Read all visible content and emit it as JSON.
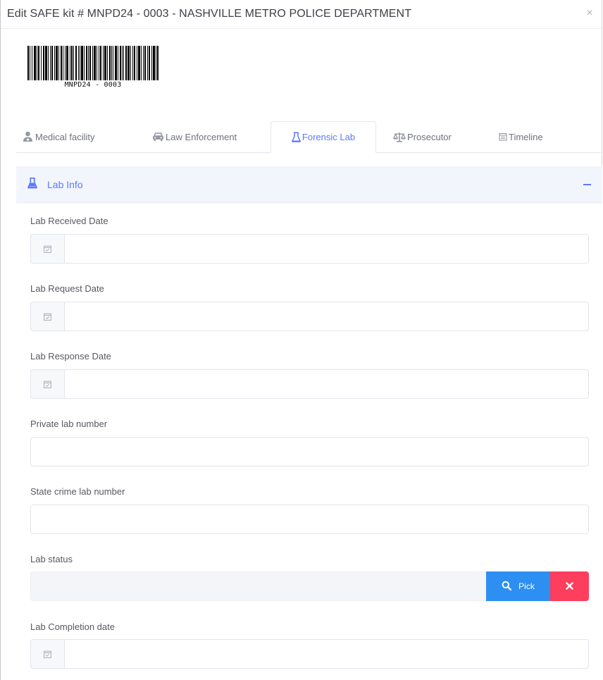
{
  "modal": {
    "title": "Edit SAFE kit # MNPD24 - 0003 - NASHVILLE METRO POLICE DEPARTMENT",
    "close_icon": "close-icon"
  },
  "barcode": {
    "text": "MNPD24 - 0003"
  },
  "tabs": [
    {
      "label": "Medical facility",
      "icon": "user-medical-icon",
      "active": false
    },
    {
      "label": "Law Enforcement",
      "icon": "police-car-icon",
      "active": false
    },
    {
      "label": "Forensic Lab",
      "icon": "flask-icon",
      "active": true
    },
    {
      "label": "Prosecutor",
      "icon": "balance-scale-icon",
      "active": false
    },
    {
      "label": "Timeline",
      "icon": "calendar-icon",
      "active": false
    }
  ],
  "section": {
    "title": "Lab Info",
    "icon": "flask-icon",
    "toggle_icon": "minus-icon"
  },
  "fields": {
    "lab_received_date": {
      "label": "Lab Received Date",
      "value": "",
      "icon": "calendar-check-icon"
    },
    "lab_request_date": {
      "label": "Lab Request Date",
      "value": "",
      "icon": "calendar-check-icon"
    },
    "lab_response_date": {
      "label": "Lab Response Date",
      "value": "",
      "icon": "calendar-check-icon"
    },
    "private_lab_number": {
      "label": "Private lab number",
      "value": ""
    },
    "state_crime_lab_number": {
      "label": "State crime lab number",
      "value": ""
    },
    "lab_status": {
      "label": "Lab status",
      "value": "",
      "pick_label": "Pick",
      "pick_icon": "search-icon",
      "clear_icon": "x-icon"
    },
    "lab_completion_date": {
      "label": "Lab Completion date",
      "value": "",
      "icon": "calendar-check-icon"
    }
  },
  "colors": {
    "accent": "#5d78ff",
    "pick_button": "#2d8ff1",
    "clear_button": "#fd3e5c"
  }
}
